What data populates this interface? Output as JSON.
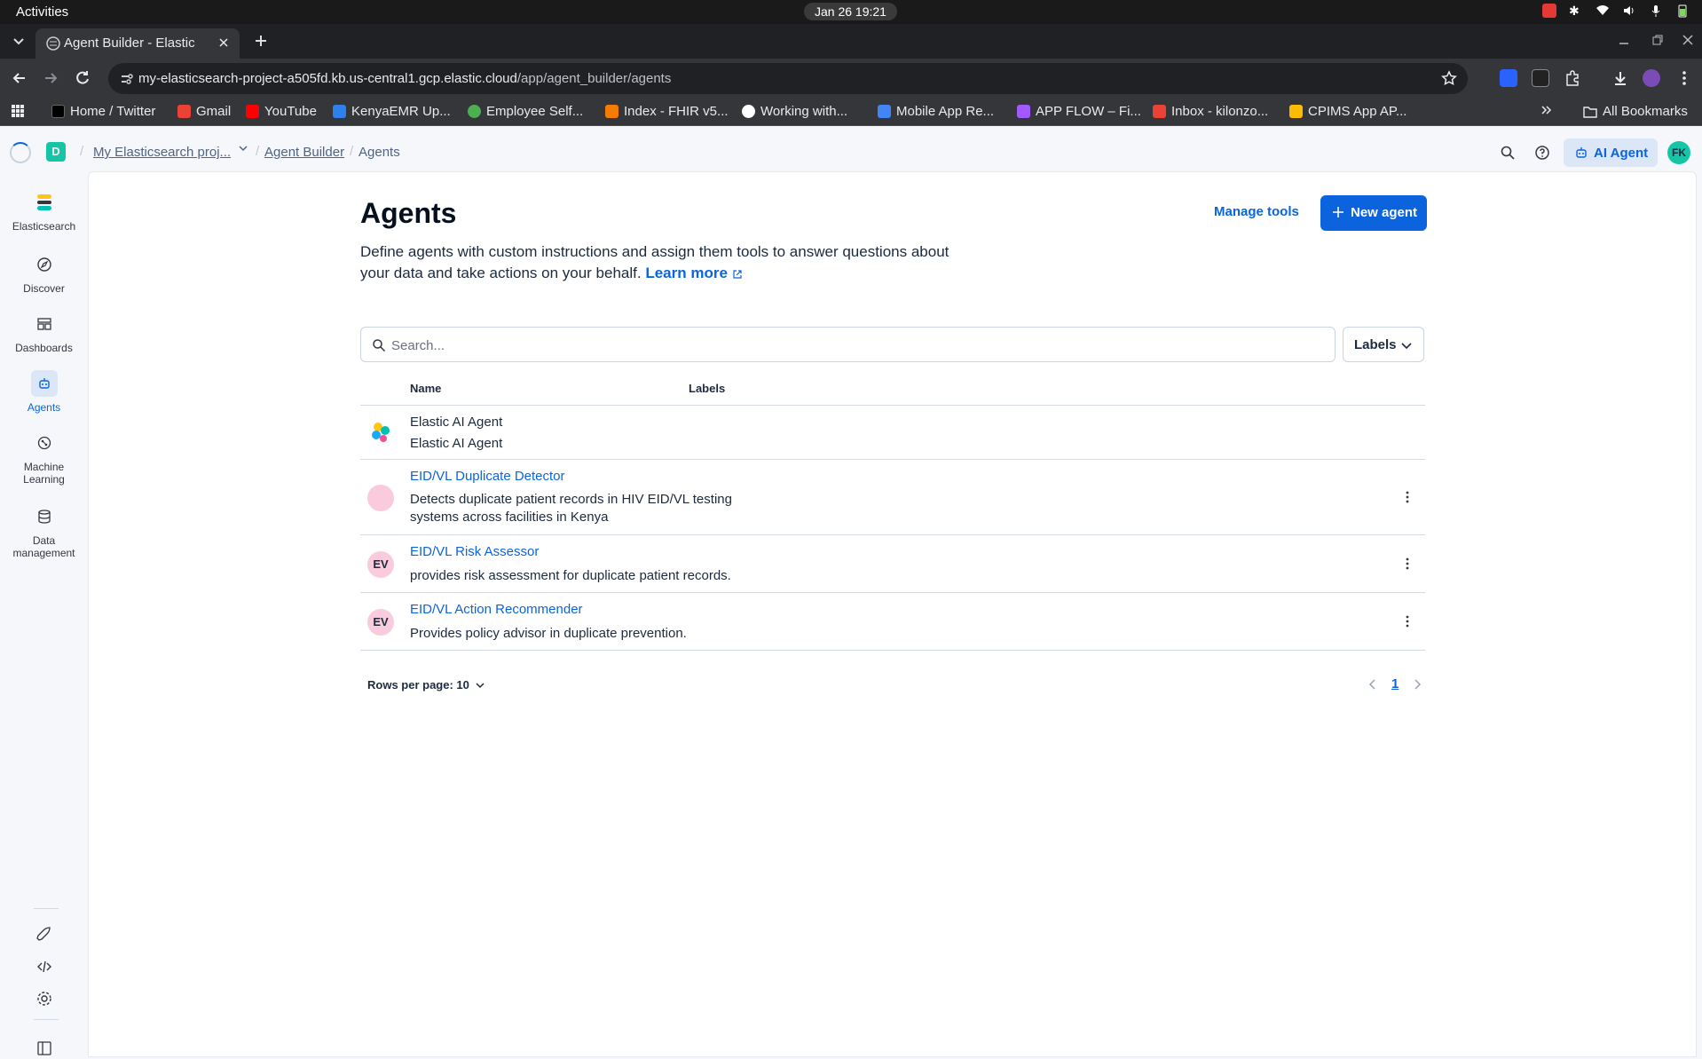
{
  "os": {
    "activities": "Activities",
    "clock": "Jan 26  19:21"
  },
  "browser": {
    "tab_title": "Agent Builder - Elastic",
    "url_host": "my-elasticsearch-project-a505fd.kb.us-central1.gcp.elastic.cloud",
    "url_path": "/app/agent_builder/agents",
    "bookmarks": [
      {
        "label": "Home / Twitter",
        "color": "#000000"
      },
      {
        "label": "Gmail",
        "color": "#ea4335"
      },
      {
        "label": "YouTube",
        "color": "#ff0000"
      },
      {
        "label": "KenyaEMR Up...",
        "color": "#2f80ed"
      },
      {
        "label": "Employee Self...",
        "color": "#4caf50"
      },
      {
        "label": "Index - FHIR v5...",
        "color": "#f57c00"
      },
      {
        "label": "Working with...",
        "color": "#ffffff"
      },
      {
        "label": "Mobile App Re...",
        "color": "#4285f4"
      },
      {
        "label": "APP FLOW – Fi...",
        "color": "#a259ff"
      },
      {
        "label": "Inbox - kilonzo...",
        "color": "#ea4335"
      },
      {
        "label": "CPIMS App AP...",
        "color": "#fbbc04"
      }
    ],
    "all_bookmarks": "All Bookmarks"
  },
  "header": {
    "space_letter": "D",
    "breadcrumbs": [
      "My Elasticsearch proj...",
      "Agent Builder",
      "Agents"
    ],
    "ai_agent_label": "AI Agent",
    "avatar_initials": "FK"
  },
  "sidenav": {
    "brand": "Elasticsearch",
    "items": [
      "Discover",
      "Dashboards",
      "Agents",
      "Machine Learning",
      "Data management"
    ]
  },
  "page": {
    "title": "Agents",
    "description": "Define agents with custom instructions and assign them tools to answer questions about your data and take actions on your behalf.",
    "learn_more": "Learn more",
    "manage_tools": "Manage tools",
    "new_agent": "New agent",
    "search_placeholder": "Search...",
    "labels_button": "Labels"
  },
  "table": {
    "headers": {
      "name": "Name",
      "labels": "Labels"
    },
    "rows": [
      {
        "name": "Elastic AI Agent",
        "description": "Elastic AI Agent",
        "avatar": ""
      },
      {
        "name": "EID/VL Duplicate Detector",
        "description": "Detects duplicate patient records in HIV EID/VL testing systems across facilities in Kenya",
        "avatar": ""
      },
      {
        "name": "EID/VL Risk Assessor",
        "description": "provides risk assessment for duplicate patient records.",
        "avatar": "EV"
      },
      {
        "name": "EID/VL Action Recommender",
        "description": "Provides policy advisor in duplicate prevention.",
        "avatar": "EV"
      }
    ]
  },
  "pagination": {
    "rows_per_page": "Rows per page: 10",
    "current_page": "1"
  },
  "colors": {
    "primary": "#0b64dd",
    "avatar_pink": "#f9cbdc",
    "space_teal": "#16c5a6"
  }
}
